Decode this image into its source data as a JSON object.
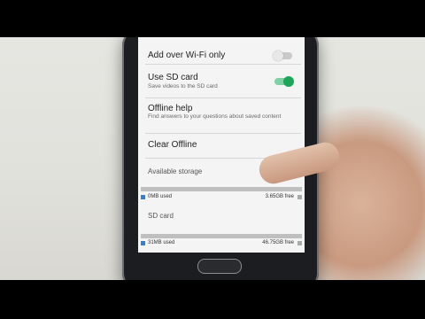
{
  "settings": {
    "wifi_only": {
      "title": "Add over Wi-Fi only",
      "enabled": false
    },
    "use_sd": {
      "title": "Use SD card",
      "subtitle": "Save videos to the SD card",
      "enabled": true
    },
    "offline_help": {
      "title": "Offline help",
      "subtitle": "Find answers to your questions about saved content"
    },
    "clear_offline": {
      "title": "Clear Offline"
    }
  },
  "storage": {
    "available_label": "Available storage",
    "internal": {
      "used": "0MB used",
      "free": "3.65GB free"
    },
    "sd_label": "SD card",
    "sd": {
      "used": "31MB used",
      "free": "46.75GB free"
    }
  },
  "colors": {
    "toggle_on": "#1ea55a",
    "used_marker": "#2f80d8"
  }
}
